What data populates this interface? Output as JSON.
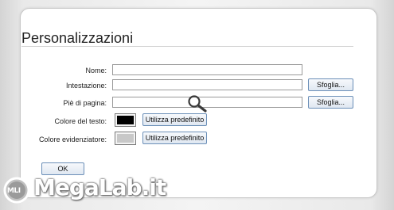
{
  "section": {
    "title": "Personalizzazioni"
  },
  "form": {
    "name_label": "Nome:",
    "name_value": "",
    "header_label": "Intestazione:",
    "header_value": "",
    "header_browse_label": "Sfoglia...",
    "footer_label": "Piè di pagina:",
    "footer_value": "",
    "footer_browse_label": "Sfoglia...",
    "text_color_label": "Colore del testo:",
    "text_color_value": "#000000",
    "text_color_default_label": "Utilizza predefinito",
    "highlight_color_label": "Colore evidenziatore:",
    "highlight_color_value": "#c8c8c8",
    "highlight_color_default_label": "Utilizza predefinito",
    "ok_label": "OK"
  },
  "watermark": {
    "text": "MegaLab.it",
    "badge_text": "MLI"
  },
  "icons": {
    "cursor": "magnifier-icon"
  }
}
